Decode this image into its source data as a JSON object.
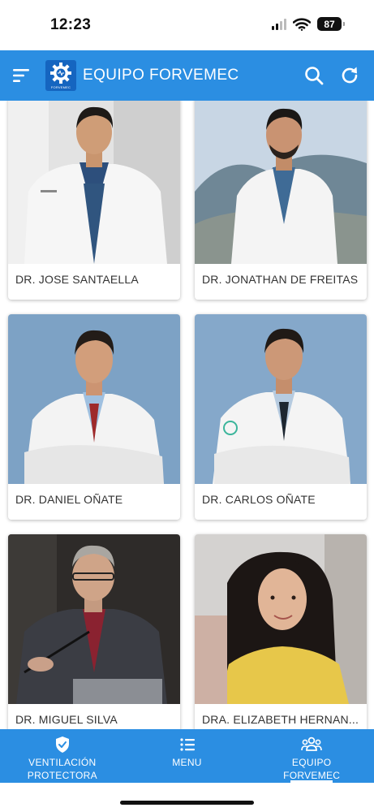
{
  "status_bar": {
    "time": "12:23",
    "battery": "87"
  },
  "app_bar": {
    "logo_text": "FORVEMEC",
    "title": "EQUIPO FORVEMEC"
  },
  "doctors": [
    {
      "name": "DR. JOSE SANTAELLA"
    },
    {
      "name": "DR. JONATHAN DE FREITAS"
    },
    {
      "name": "DR. DANIEL OÑATE"
    },
    {
      "name": "DR. CARLOS OÑATE"
    },
    {
      "name": "DR. MIGUEL SILVA"
    },
    {
      "name": "DRA. ELIZABETH HERNAN..."
    }
  ],
  "bottom_nav": {
    "items": [
      {
        "label": "VENTILACIÓN PROTECTORA",
        "icon": "shield-check-icon"
      },
      {
        "label": "MENU",
        "icon": "list-icon"
      },
      {
        "label": "EQUIPO FORVEMEC",
        "icon": "group-icon",
        "active": true
      }
    ]
  },
  "colors": {
    "primary": "#2b8ee2",
    "logo_bg": "#1565c0"
  }
}
